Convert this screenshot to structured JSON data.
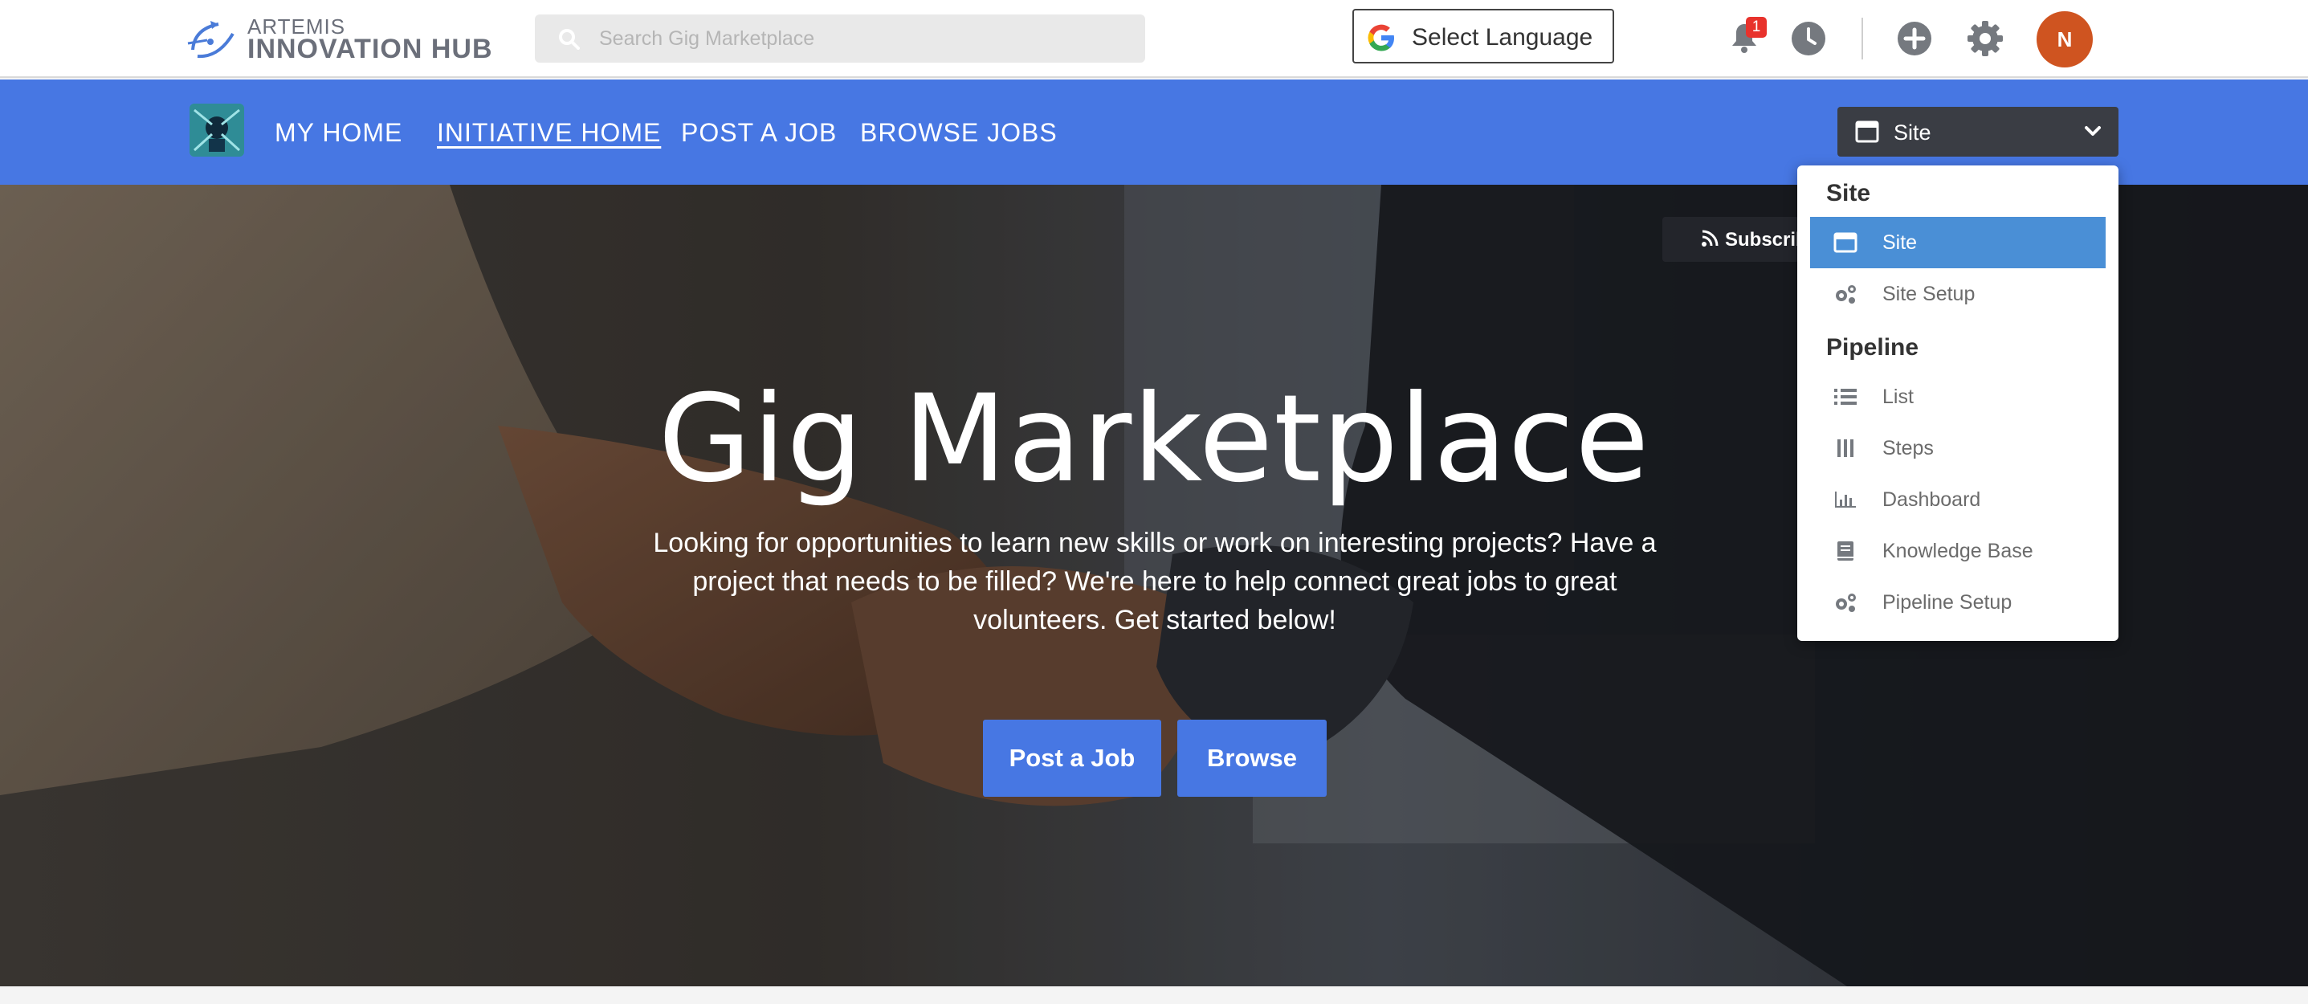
{
  "header": {
    "logo_top": "ARTEMIS",
    "logo_bottom": "INNOVATION HUB",
    "search_placeholder": "Search Gig Marketplace",
    "language_label": "Select Language",
    "notification_count": "1",
    "avatar_initial": "N"
  },
  "nav": {
    "items": [
      {
        "label": "MY HOME",
        "active": false
      },
      {
        "label": "INITIATIVE HOME",
        "active": true
      },
      {
        "label": "POST A JOB",
        "active": false
      },
      {
        "label": "BROWSE JOBS",
        "active": false
      }
    ],
    "site_switcher_label": "Site"
  },
  "hero": {
    "title": "Gig Marketplace",
    "description": "Looking for opportunities to learn new skills or work on interesting projects? Have a project that needs to be filled? We're here to help connect great jobs to great volunteers. Get started below!",
    "post_button": "Post a Job",
    "browse_button": "Browse",
    "subscribe_label": "Subscribe"
  },
  "dropdown": {
    "sections": [
      {
        "heading": "Site",
        "items": [
          {
            "label": "Site",
            "icon": "window-icon",
            "selected": true
          },
          {
            "label": "Site Setup",
            "icon": "gears-icon",
            "selected": false
          }
        ]
      },
      {
        "heading": "Pipeline",
        "items": [
          {
            "label": "List",
            "icon": "list-icon",
            "selected": false
          },
          {
            "label": "Steps",
            "icon": "columns-icon",
            "selected": false
          },
          {
            "label": "Dashboard",
            "icon": "bar-chart-icon",
            "selected": false
          },
          {
            "label": "Knowledge Base",
            "icon": "book-icon",
            "selected": false
          },
          {
            "label": "Pipeline Setup",
            "icon": "gears-icon",
            "selected": false
          }
        ]
      }
    ]
  },
  "colors": {
    "nav_blue": "#4777e3",
    "selected_blue": "#4a8fd6",
    "avatar_orange": "#cf5420",
    "badge_red": "#e8322c"
  }
}
